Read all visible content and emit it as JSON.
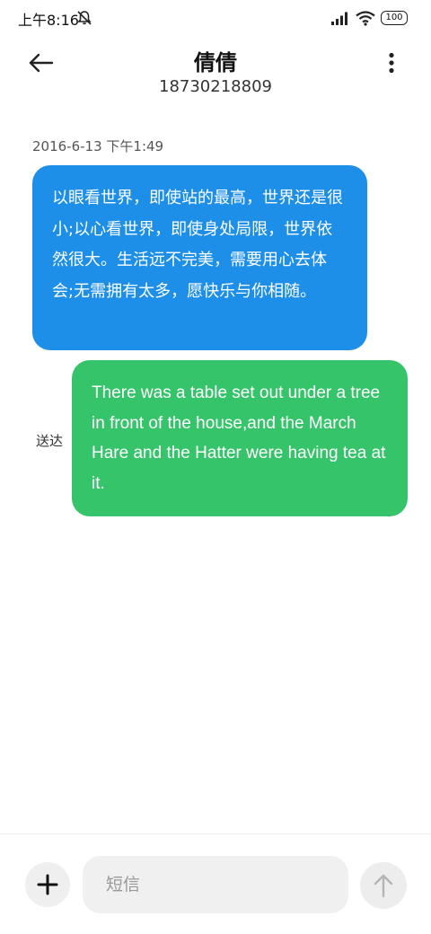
{
  "status_bar": {
    "time": "上午8:16",
    "battery": "100",
    "icons": [
      "mute-icon",
      "signal-icon",
      "wifi-icon",
      "battery-icon"
    ]
  },
  "header": {
    "contact_name": "倩倩",
    "contact_number": "18730218809",
    "icons": [
      "back-arrow-icon",
      "more-vertical-icon"
    ]
  },
  "conversation": {
    "timestamp": "2016-6-13 下午1:49",
    "messages": [
      {
        "direction": "incoming",
        "text": "以眼看世界，即使站的最高，世界还是很小;以心看世界，即使身处局限，世界依然很大。生活远不完美，需要用心去体会;无需拥有太多，愿快乐与你相随。",
        "color": "#1d8fe8"
      },
      {
        "direction": "outgoing",
        "text": "There was a table set out under a tree in front of the house,and the March Hare and the Hatter were having tea at it.",
        "status": "送达",
        "color": "#36c46b"
      }
    ]
  },
  "composer": {
    "placeholder": "短信",
    "value": "",
    "icons": [
      "plus-icon",
      "send-arrow-icon"
    ]
  }
}
